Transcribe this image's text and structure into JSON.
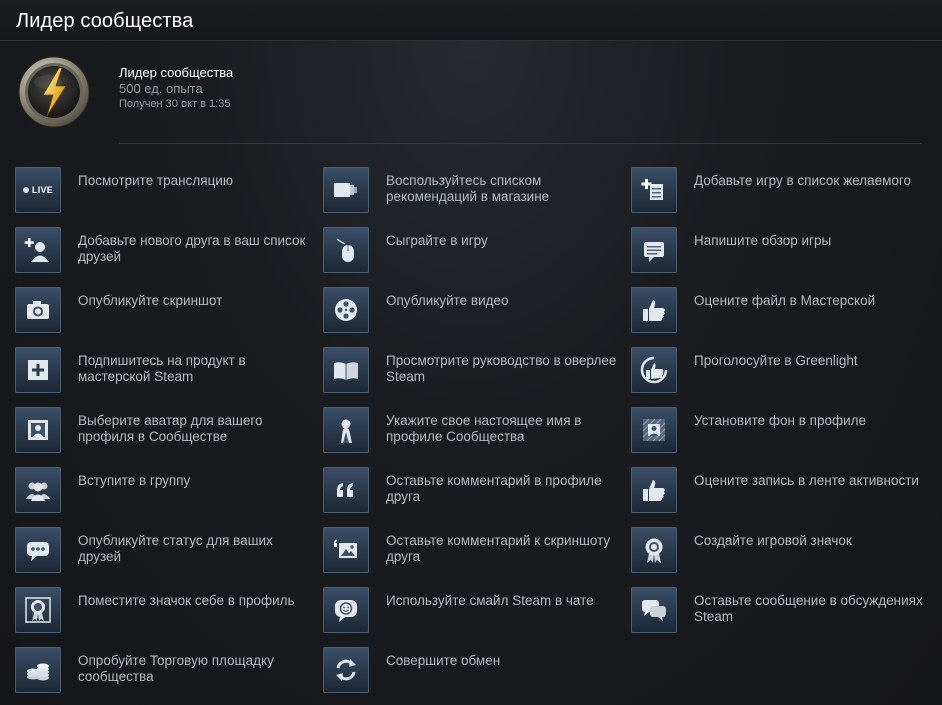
{
  "header": {
    "title": "Лидер сообщества"
  },
  "badge": {
    "name": "Лидер сообщества",
    "xp": "500 ед. опыта",
    "unlocked": "Получен 30 окт в 1:35",
    "icon": "lightning-medal-icon"
  },
  "tasks": [
    {
      "label": "Посмотрите трансляцию",
      "icon": "live-broadcast-icon",
      "badge": "LIVE"
    },
    {
      "label": "Воспользуйтесь списком рекомендаций в магазине",
      "icon": "discovery-queue-icon"
    },
    {
      "label": "Добавьте игру в список желаемого",
      "icon": "wishlist-add-icon"
    },
    {
      "label": "Добавьте нового друга в ваш список друзей",
      "icon": "add-friend-icon"
    },
    {
      "label": "Сыграйте в игру",
      "icon": "mouse-icon"
    },
    {
      "label": "Напишите обзор игры",
      "icon": "review-icon"
    },
    {
      "label": "Опубликуйте скриншот",
      "icon": "camera-icon"
    },
    {
      "label": "Опубликуйте видео",
      "icon": "film-reel-icon"
    },
    {
      "label": "Оцените файл в Мастерской",
      "icon": "thumbs-up-icon"
    },
    {
      "label": "Подпишитесь на продукт в мастерской Steam",
      "icon": "subscribe-plus-icon"
    },
    {
      "label": "Просмотрите руководство в оверлее Steam",
      "icon": "open-book-icon"
    },
    {
      "label": "Проголосуйте в Greenlight",
      "icon": "greenlight-thumb-icon"
    },
    {
      "label": "Выберите аватар для вашего профиля в Сообществе",
      "icon": "avatar-frame-icon"
    },
    {
      "label": "Укажите свое настоящее имя в профиле Сообщества",
      "icon": "real-name-silhouette-icon"
    },
    {
      "label": "Установите фон в профиле",
      "icon": "profile-background-icon"
    },
    {
      "label": "Вступите в группу",
      "icon": "group-icon"
    },
    {
      "label": "Оставьте комментарий в профиле друга",
      "icon": "quote-icon"
    },
    {
      "label": "Оцените запись в ленте активности",
      "icon": "thumbs-up-icon"
    },
    {
      "label": "Опубликуйте статус для ваших друзей",
      "icon": "status-bubble-icon"
    },
    {
      "label": "Оставьте комментарий к скриншоту друга",
      "icon": "screenshot-comment-icon"
    },
    {
      "label": "Создайте игровой значок",
      "icon": "craft-badge-icon"
    },
    {
      "label": "Поместите значок себе в профиль",
      "icon": "featured-badge-icon"
    },
    {
      "label": "Используйте смайл Steam в чате",
      "icon": "emoticon-icon"
    },
    {
      "label": "Оставьте сообщение в обсуждениях Steam",
      "icon": "discussion-icon"
    },
    {
      "label": "Опробуйте Торговую площадку сообщества",
      "icon": "market-coins-icon"
    },
    {
      "label": "Совершите обмен",
      "icon": "trade-arrows-icon"
    }
  ],
  "colors": {
    "background": "#161719",
    "icon_tile": "#2c3d52",
    "icon_border": "#4b5f74",
    "text": "#b1bac2",
    "title": "#ffffff"
  }
}
